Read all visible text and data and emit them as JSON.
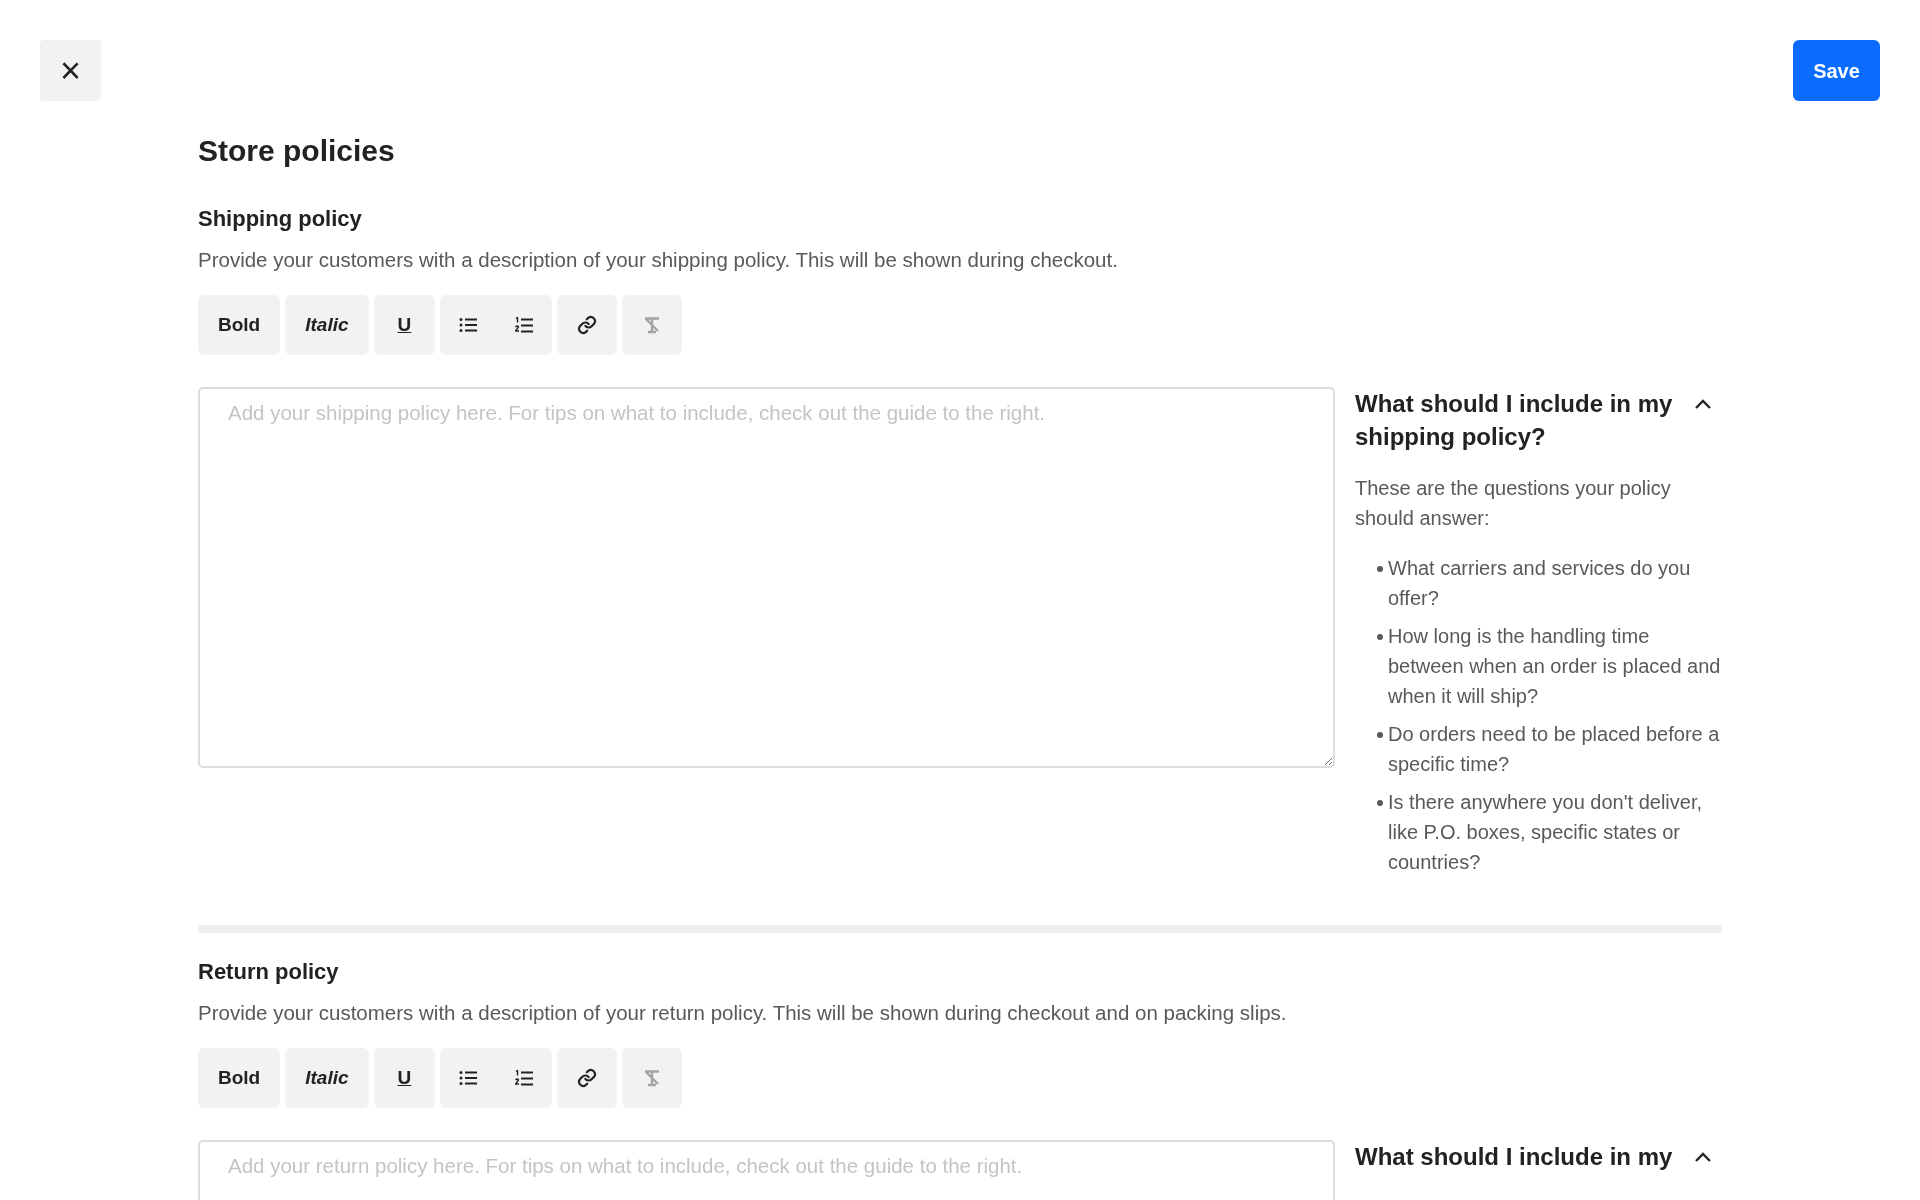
{
  "header": {
    "close": "×",
    "save": "Save"
  },
  "title": "Store policies",
  "sections": [
    {
      "heading": "Shipping policy",
      "description": "Provide your customers with a description of your shipping policy. This will be shown during checkout.",
      "toolbar": [
        [
          {
            "kind": "bold",
            "label": "Bold",
            "disabled": false
          }
        ],
        [
          {
            "kind": "italic",
            "label": "Italic",
            "disabled": false
          }
        ],
        [
          {
            "kind": "underline",
            "label": "U",
            "disabled": false
          }
        ],
        [
          {
            "kind": "bullets",
            "disabled": false
          },
          {
            "kind": "numbers",
            "disabled": false
          }
        ],
        [
          {
            "kind": "link",
            "disabled": false
          }
        ],
        [
          {
            "kind": "clear",
            "disabled": true
          }
        ]
      ],
      "editor": {
        "placeholder": "Add your shipping policy here. For tips on what to include, check out the guide to the right."
      },
      "guide": {
        "title": "What should I include in my shipping policy?",
        "expanded": true,
        "intro": "These are the questions your policy should answer:",
        "items": [
          "What carriers and services do you offer?",
          "How long is the handling time between when an order is placed and when it will ship?",
          "Do orders need to be placed before a specific time?",
          "Is there anywhere you don't deliver, like P.O. boxes, specific states or countries?"
        ]
      }
    },
    {
      "heading": "Return policy",
      "description": "Provide your customers with a description of your return policy. This will be shown during checkout and on packing slips.",
      "toolbar": [
        [
          {
            "kind": "bold",
            "label": "Bold",
            "disabled": false
          }
        ],
        [
          {
            "kind": "italic",
            "label": "Italic",
            "disabled": false
          }
        ],
        [
          {
            "kind": "underline",
            "label": "U",
            "disabled": false
          }
        ],
        [
          {
            "kind": "bullets",
            "disabled": false
          },
          {
            "kind": "numbers",
            "disabled": false
          }
        ],
        [
          {
            "kind": "link",
            "disabled": false
          }
        ],
        [
          {
            "kind": "clear",
            "disabled": true
          }
        ]
      ],
      "editor": {
        "placeholder": "Add your return policy here. For tips on what to include, check out the guide to the right."
      },
      "guide": {
        "title": "What should I include in my",
        "expanded": true
      }
    }
  ]
}
